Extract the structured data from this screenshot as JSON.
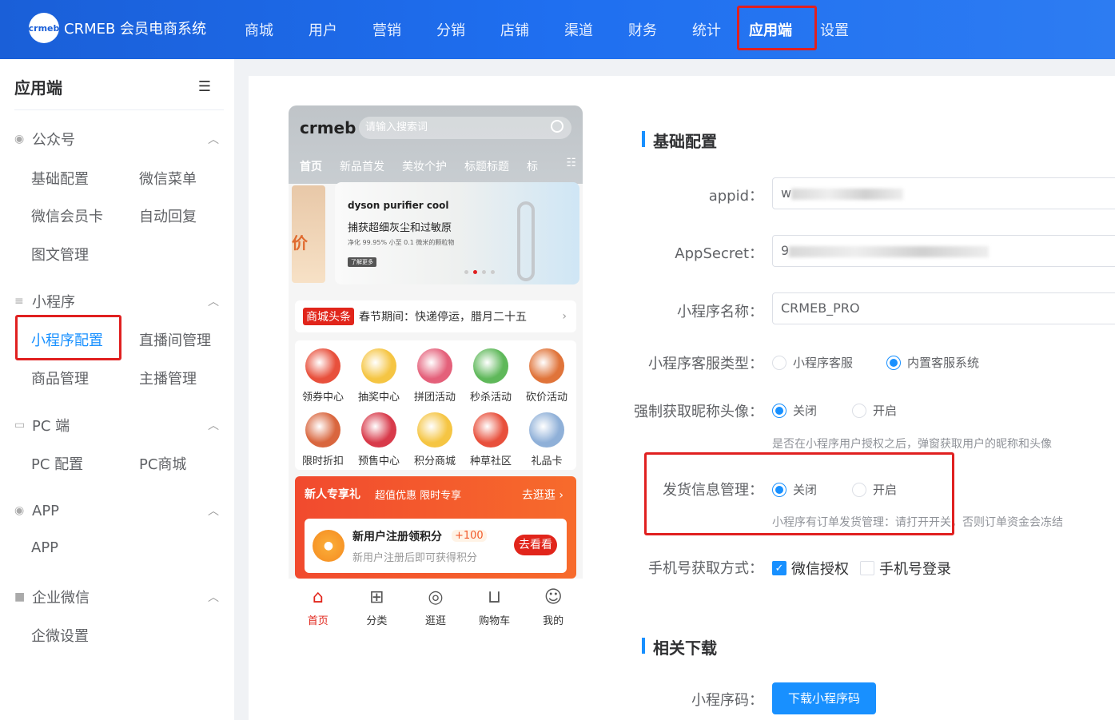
{
  "app": {
    "logo_mark": "crmeb",
    "title": "CRMEB 会员电商系统"
  },
  "topnav": [
    "商城",
    "用户",
    "营销",
    "分销",
    "店铺",
    "渠道",
    "财务",
    "统计",
    "应用端",
    "设置"
  ],
  "sidebar": {
    "title": "应用端",
    "groups": {
      "gzh": "公众号",
      "mini": "小程序",
      "pc": "PC 端",
      "app": "APP",
      "wecom": "企业微信"
    },
    "items": {
      "basic_config": "基础配置",
      "wx_menu": "微信菜单",
      "wx_card": "微信会员卡",
      "auto_reply": "自动回复",
      "article": "图文管理",
      "mini_config": "小程序配置",
      "live_room": "直播间管理",
      "goods": "商品管理",
      "anchor": "主播管理",
      "pc_config": "PC 配置",
      "pc_mall": "PC商城",
      "app_item": "APP",
      "wecom_settings": "企微设置"
    }
  },
  "phone": {
    "logo": "crmeb",
    "search_placeholder": "请输入搜索词",
    "tabs": [
      "首页",
      "新品首发",
      "美妆个护",
      "标题标题",
      "标"
    ],
    "banner": {
      "brand": "dyson purifier cool",
      "line1": "捕获超细灰尘和过敏原",
      "line2": "净化 99.95% 小至 0.1 微米的颗粒物",
      "btn": "了解更多",
      "left_text": "价"
    },
    "news": {
      "tag": "商城头条",
      "text": "春节期间：快递停运，腊月二十五"
    },
    "icons": [
      {
        "label": "领券中心",
        "color": "#e8503c"
      },
      {
        "label": "抽奖中心",
        "color": "#f5c543"
      },
      {
        "label": "拼团活动",
        "color": "#e4607a"
      },
      {
        "label": "秒杀活动",
        "color": "#5fb85a"
      },
      {
        "label": "砍价活动",
        "color": "#e0743a"
      },
      {
        "label": "限时折扣",
        "color": "#d9663e"
      },
      {
        "label": "预售中心",
        "color": "#d83a4a"
      },
      {
        "label": "积分商城",
        "color": "#f5c543"
      },
      {
        "label": "种草社区",
        "color": "#e8503c"
      },
      {
        "label": "礼品卡",
        "color": "#8fb0d8"
      }
    ],
    "promo": {
      "title": "新人专享礼",
      "sub": "超值优惠 限时专享",
      "more": "去逛逛 ›",
      "card_name": "新用户注册领积分",
      "card_points": "+100",
      "card_desc": "新用户注册后即可获得积分",
      "card_btn": "去看看"
    },
    "tabbar": [
      "首页",
      "分类",
      "逛逛",
      "购物车",
      "我的"
    ]
  },
  "form": {
    "section_basic": "基础配置",
    "appid_label": "appid：",
    "appid_value": "w",
    "appsecret_label": "AppSecret：",
    "appsecret_value": "9",
    "mini_name_label": "小程序名称：",
    "mini_name_value": "CRMEB_PRO",
    "service_label": "小程序客服类型：",
    "service_opt1": "小程序客服",
    "service_opt2": "内置客服系统",
    "force_label": "强制获取昵称头像：",
    "force_off": "关闭",
    "force_on": "开启",
    "force_hint": "是否在小程序用户授权之后，弹窗获取用户的昵称和头像",
    "ship_label": "发货信息管理：",
    "ship_off": "关闭",
    "ship_on": "开启",
    "ship_hint": "小程序有订单发货管理：请打开开关，否则订单资金会冻结",
    "phone_label": "手机号获取方式：",
    "phone_opt1": "微信授权",
    "phone_opt2": "手机号登录",
    "section_download": "相关下载",
    "qrcode_label": "小程序码：",
    "download_btn": "下载小程序码"
  },
  "colors": {
    "primary": "#1890ff",
    "highlight": "#e02020",
    "topbar": "#1f6ff0"
  }
}
